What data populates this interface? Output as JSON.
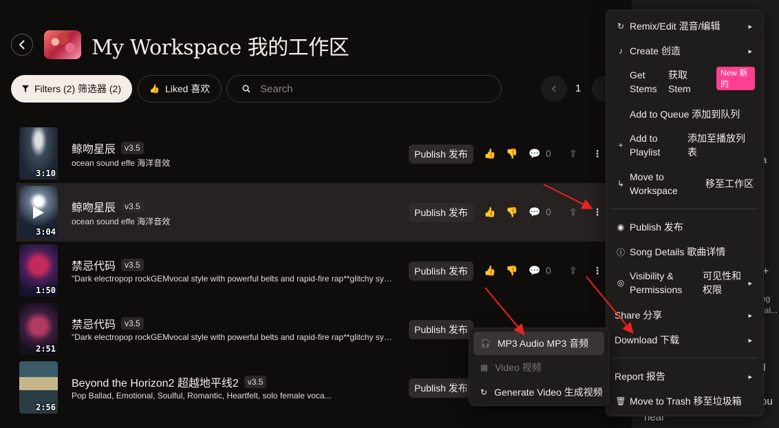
{
  "header": {
    "title": "My Workspace  我的工作区"
  },
  "toolbar": {
    "filters_label": "Filters (2)  筛选器 (2)",
    "liked_label": "Liked  喜欢",
    "search_placeholder": "Search",
    "page": "1"
  },
  "songs": [
    {
      "title": "鲸吻星辰",
      "version": "v3.5",
      "desc": "ocean sound effe  海洋音效",
      "duration": "3:10",
      "publish": "Publish  发布",
      "comments": "0"
    },
    {
      "title": "鲸吻星辰",
      "version": "v3.5",
      "desc": "ocean sound effe  海洋音效",
      "duration": "3:04",
      "publish": "Publish  发布",
      "comments": "0"
    },
    {
      "title": "禁忌代码",
      "version": "v3.5",
      "desc": "\"Dark electropop rockGEMvocal style with powerful belts and rapid-fire rap**glitchy synth ...",
      "duration": "1:50",
      "publish": "Publish  发布",
      "comments": "0"
    },
    {
      "title": "禁忌代码",
      "version": "v3.5",
      "desc": "\"Dark electropop rockGEMvocal style with powerful belts and rapid-fire rap**glitchy synth ...",
      "duration": "2:51",
      "publish": "Publish  发布",
      "comments": "0"
    },
    {
      "title": "Beyond the Horizon2  超越地平线2",
      "version": "v3.5",
      "desc": "Pop Ballad, Emotional, Soulful, Romantic, Heartfelt, solo female voca...",
      "duration": "2:56",
      "publish": "Publish  发布",
      "comments": ""
    }
  ],
  "menu": {
    "remix": "Remix/Edit  混音/编辑",
    "create": "Create  创造",
    "get_stems_en": "Get Stems",
    "get_stems_zh": "获取 Stem",
    "new_badge": "New  新的",
    "add_queue": "Add to Queue  添加到队列",
    "add_playlist_en": "Add to Playlist",
    "add_playlist_zh": "添加至播放列表",
    "move_ws_en": "Move to Workspace",
    "move_ws_zh": "移至工作区",
    "publish": "Publish  发布",
    "details": "Song Details  歌曲详情",
    "visibility_en": "Visibility & Permissions",
    "visibility_zh": "可见性和权限",
    "share": "Share  分享",
    "download": "Download  下载",
    "report": "Report  报告",
    "trash": "Move to Trash  移至垃圾箱"
  },
  "submenu": {
    "mp3": "MP3 Audio  MP3 音频",
    "video": "Video  视频",
    "gen_video": "Generate Video  生成视频"
  },
  "side": {
    "t1": "a",
    "t2": "ng",
    "t3": "entral...",
    "t4": "ll",
    "t5": "ou",
    "t6": "near"
  },
  "colors": {
    "accent_badge": "#ff3f91",
    "arrow": "#e8231f"
  }
}
